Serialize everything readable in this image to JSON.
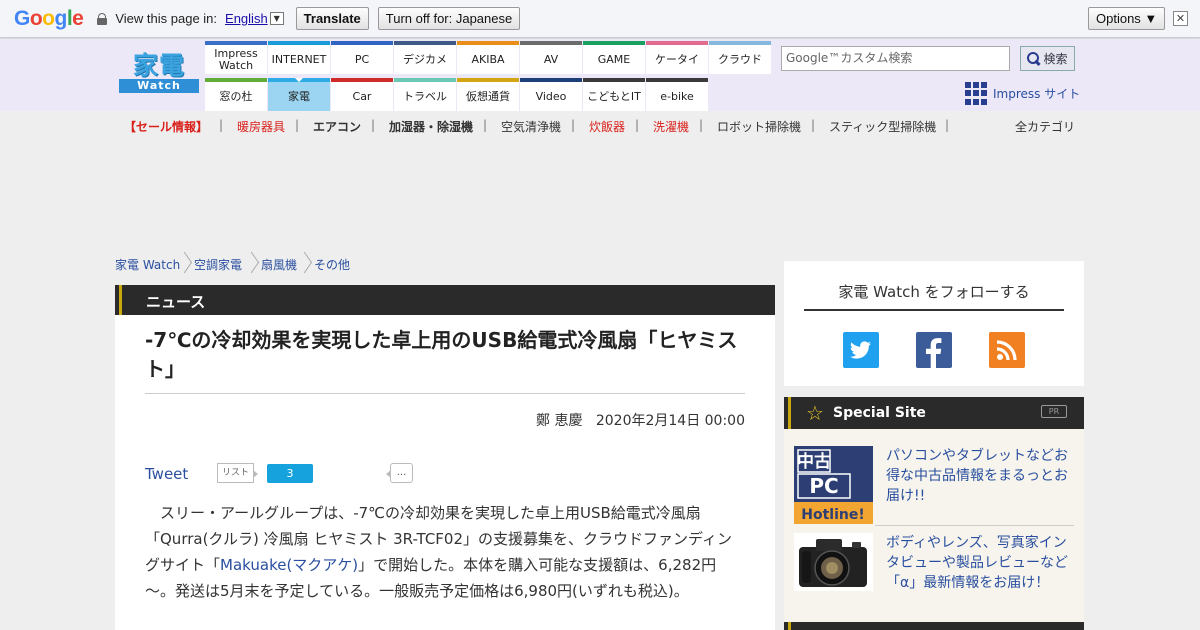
{
  "translate_bar": {
    "logo_letters": [
      {
        "ch": "G",
        "color": "#4285f4"
      },
      {
        "ch": "o",
        "color": "#ea4335"
      },
      {
        "ch": "o",
        "color": "#fbbc05"
      },
      {
        "ch": "g",
        "color": "#4285f4"
      },
      {
        "ch": "l",
        "color": "#34a853"
      },
      {
        "ch": "e",
        "color": "#ea4335"
      }
    ],
    "prompt": "View this page in:",
    "language": "English",
    "translate_button": "Translate",
    "turn_off_button": "Turn off for: Japanese",
    "options_button": "Options ▼",
    "close": "✕"
  },
  "header": {
    "logo_kanji": "家電",
    "logo_sub": "Watch",
    "nav_top": [
      {
        "label": "Impress\nWatch",
        "color": "#3a6fc8"
      },
      {
        "label": "INTERNET",
        "color": "#1b9bd8"
      },
      {
        "label": "PC",
        "color": "#2f66c4"
      },
      {
        "label": "デジカメ",
        "color": "#3d5a86"
      },
      {
        "label": "AKIBA",
        "color": "#e88e19"
      },
      {
        "label": "AV",
        "color": "#6b6b6b"
      },
      {
        "label": "GAME",
        "color": "#1aa162"
      },
      {
        "label": "ケータイ",
        "color": "#e26a8f"
      },
      {
        "label": "クラウド",
        "color": "#85b8dd"
      }
    ],
    "nav_bottom": [
      {
        "label": "窓の杜",
        "color": "#60ad3a"
      },
      {
        "label": "家電",
        "color": "#2eaae5"
      },
      {
        "label": "Car",
        "color": "#d02b2b"
      },
      {
        "label": "トラベル",
        "color": "#6bc8b4"
      },
      {
        "label": "仮想通貨",
        "color": "#d3a514"
      },
      {
        "label": "Video",
        "color": "#1f3f7a"
      },
      {
        "label": "こどもとIT",
        "color": "#3a3a3a"
      },
      {
        "label": "e-bike",
        "color": "#3a3a3a"
      }
    ],
    "search_placeholder": "Google™カスタム検索",
    "search_button": "検索",
    "impress_link": "Impress サイト"
  },
  "categories": [
    {
      "label": "【セール情報】",
      "style": "red bold"
    },
    {
      "label": "暖房器具",
      "style": "red"
    },
    {
      "label": "エアコン",
      "style": "dark bold"
    },
    {
      "label": "加湿器・除湿機",
      "style": "dark bold"
    },
    {
      "label": "空気清浄機",
      "style": "plain"
    },
    {
      "label": "炊飯器",
      "style": "red"
    },
    {
      "label": "洗濯機",
      "style": "red"
    },
    {
      "label": "ロボット掃除機",
      "style": "plain"
    },
    {
      "label": "スティック型掃除機",
      "style": "plain"
    }
  ],
  "all_categories": "全カテゴリ",
  "separator": "|",
  "breadcrumb": [
    "家電 Watch",
    "空調家電",
    "扇風機",
    "その他"
  ],
  "article": {
    "section": "ニュース",
    "title": "-7℃の冷却効果を実現した卓上用のUSB給電式冷風扇「ヒヤミスト」",
    "author": "鄭 恵慶",
    "date": "2020年2月14日 00:00",
    "tweet": "Tweet",
    "list_badge": "リスト",
    "count": "3",
    "more": "...",
    "body_before_link": "　スリー・アールグループは、-7℃の冷却効果を実現した卓上用USB給電式冷風扇「Qurra(クルラ) 冷風扇 ヒヤミスト 3R-TCF02」の支援募集を、クラウドファンディングサイト「",
    "body_link": "Makuake(マクアケ)",
    "body_after_link": "」で開始した。本体を購入可能な支援額は、6,282円～。発送は5月末を予定している。一般販売予定価格は6,980円(いずれも税込)。"
  },
  "sidebar": {
    "follow_title": "家電 Watch をフォローする",
    "special_title": "Special Site",
    "pr": "PR",
    "items": [
      {
        "text": "パソコンやタブレットなどお得な中古品情報をまるっとお届け!!",
        "thumb_lines": [
          "中古",
          "PC",
          "Hotline!"
        ]
      },
      {
        "text": "ボディやレンズ、写真家インタビューや製品レビューなど「α」最新情報をお届け！"
      }
    ]
  }
}
